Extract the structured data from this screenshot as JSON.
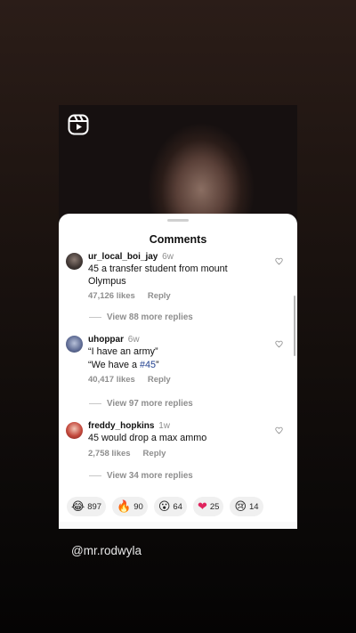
{
  "overlay_handle": "@mr.rodwyla",
  "sheet": {
    "title": "Comments"
  },
  "comments": [
    {
      "username": "ur_local_boi_jay",
      "time": "6w",
      "lines": [
        "45 a transfer student from mount Olympus"
      ],
      "likes": "47,126 likes",
      "reply": "Reply",
      "view_replies": "View 88 more replies"
    },
    {
      "username": "uhoppar",
      "time": "6w",
      "line1": "“I have an army”",
      "line2_prefix": "“We have a ",
      "line2_tag": "#45",
      "line2_suffix": "”",
      "likes": "40,417 likes",
      "reply": "Reply",
      "view_replies": "View 97 more replies"
    },
    {
      "username": "freddy_hopkins",
      "time": "1w",
      "lines": [
        "45 would drop a max ammo"
      ],
      "likes": "2,758 likes",
      "reply": "Reply",
      "view_replies": "View 34 more replies"
    }
  ],
  "reactions": [
    {
      "icon": "laughing-emoji",
      "glyph": "😂",
      "count": "897"
    },
    {
      "icon": "fire-emoji",
      "glyph": "🔥",
      "count": "90"
    },
    {
      "icon": "surprised-emoji",
      "glyph": "😮",
      "count": "64"
    },
    {
      "icon": "red-heart-emoji",
      "glyph": "❤",
      "count": "25"
    },
    {
      "icon": "crying-emoji",
      "glyph": "😢",
      "count": "14"
    }
  ],
  "icons": {
    "reels": "reels-icon",
    "like": "heart-outline-icon"
  },
  "colors": {
    "hashtag": "#1f3f8f",
    "meta_text": "#8e8e8e",
    "reaction_pill": "#f0f0f0"
  }
}
